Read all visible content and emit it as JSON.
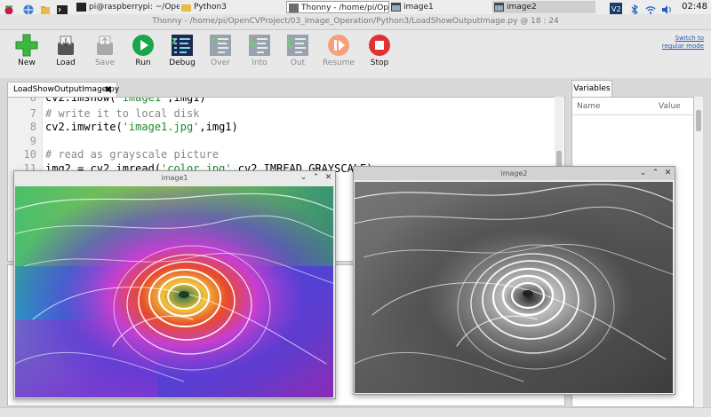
{
  "taskbar": {
    "tasks": [
      {
        "label": "pi@raspberrypi: ~/Open..."
      },
      {
        "label": "Python3"
      },
      {
        "label": "Thonny  -  /home/pi/Ope..."
      },
      {
        "label": "image1"
      },
      {
        "label": "image2"
      }
    ],
    "clock": "02:48"
  },
  "window": {
    "title": "Thonny  -  /home/pi/OpenCVProject/03_Image_Operation/Python3/LoadShowOutputImage.py  @  18 : 24"
  },
  "toolbar": {
    "buttons": [
      {
        "label": "New",
        "icon": "new-icon",
        "color": "#3fb63f"
      },
      {
        "label": "Load",
        "icon": "load-icon"
      },
      {
        "label": "Save",
        "icon": "save-icon"
      },
      {
        "label": "Run",
        "icon": "run-icon",
        "color": "#1aa64b"
      },
      {
        "label": "Debug",
        "icon": "debug-icon"
      },
      {
        "label": "Over",
        "icon": "step-over-icon"
      },
      {
        "label": "Into",
        "icon": "step-into-icon"
      },
      {
        "label": "Out",
        "icon": "step-out-icon"
      },
      {
        "label": "Resume",
        "icon": "resume-icon",
        "color": "#f5a07a"
      },
      {
        "label": "Stop",
        "icon": "stop-icon",
        "color": "#e03232"
      }
    ],
    "switch_mode_line1": "Switch to",
    "switch_mode_line2": "regular mode"
  },
  "editor": {
    "tab_label": "LoadShowOutputImage.py",
    "lines": [
      {
        "num": "6",
        "parts": [
          "cv2.imshow(",
          "'image1'",
          ",img1)"
        ]
      },
      {
        "num": "7",
        "comment": "# write it to local disk"
      },
      {
        "num": "8",
        "parts": [
          "cv2.imwrite(",
          "'image1.jpg'",
          ",img1)"
        ]
      },
      {
        "num": "9",
        "text": ""
      },
      {
        "num": "10",
        "comment": "# read as grayscale picture"
      },
      {
        "num": "11",
        "parts": [
          "img2 = cv2.imread(",
          "'color.jpg'",
          ",cv2.IMREAD_GRAYSCALE)"
        ]
      }
    ]
  },
  "variables": {
    "tab_label": "Variables",
    "col_name": "Name",
    "col_value": "Value"
  },
  "image_windows": [
    {
      "title": "image1"
    },
    {
      "title": "image2"
    }
  ],
  "accent_colors": {
    "link": "#2a5db0",
    "string": "#1d8a2a",
    "comment": "#888888"
  }
}
